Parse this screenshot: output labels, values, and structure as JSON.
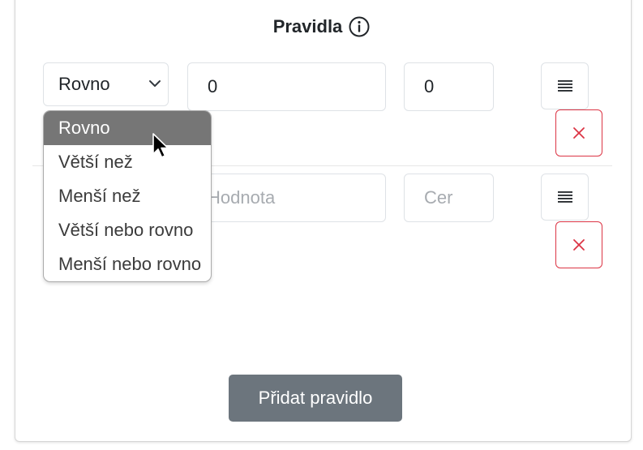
{
  "section": {
    "title": "Pravidla",
    "info_icon": "info-circle-icon"
  },
  "rules": [
    {
      "operator": "Rovno",
      "value": "0",
      "value_placeholder": "Hodnota",
      "target": "0",
      "target_placeholder": "Cer",
      "move_icon": "drag-handle-icon",
      "delete_icon": "close-icon"
    },
    {
      "operator": "",
      "value": "",
      "value_placeholder": "Hodnota",
      "target": "",
      "target_placeholder": "Cer",
      "move_icon": "drag-handle-icon",
      "delete_icon": "close-icon"
    }
  ],
  "operator_dropdown": {
    "selected": "Rovno",
    "options": [
      "Rovno",
      "Větší než",
      "Menší než",
      "Větší nebo rovno",
      "Menší nebo rovno"
    ]
  },
  "add_rule_button": "Přidat pravidlo",
  "colors": {
    "danger": "#dc3545",
    "secondary": "#6c757d",
    "option_highlight": "#767676",
    "border": "#dee2e6"
  }
}
